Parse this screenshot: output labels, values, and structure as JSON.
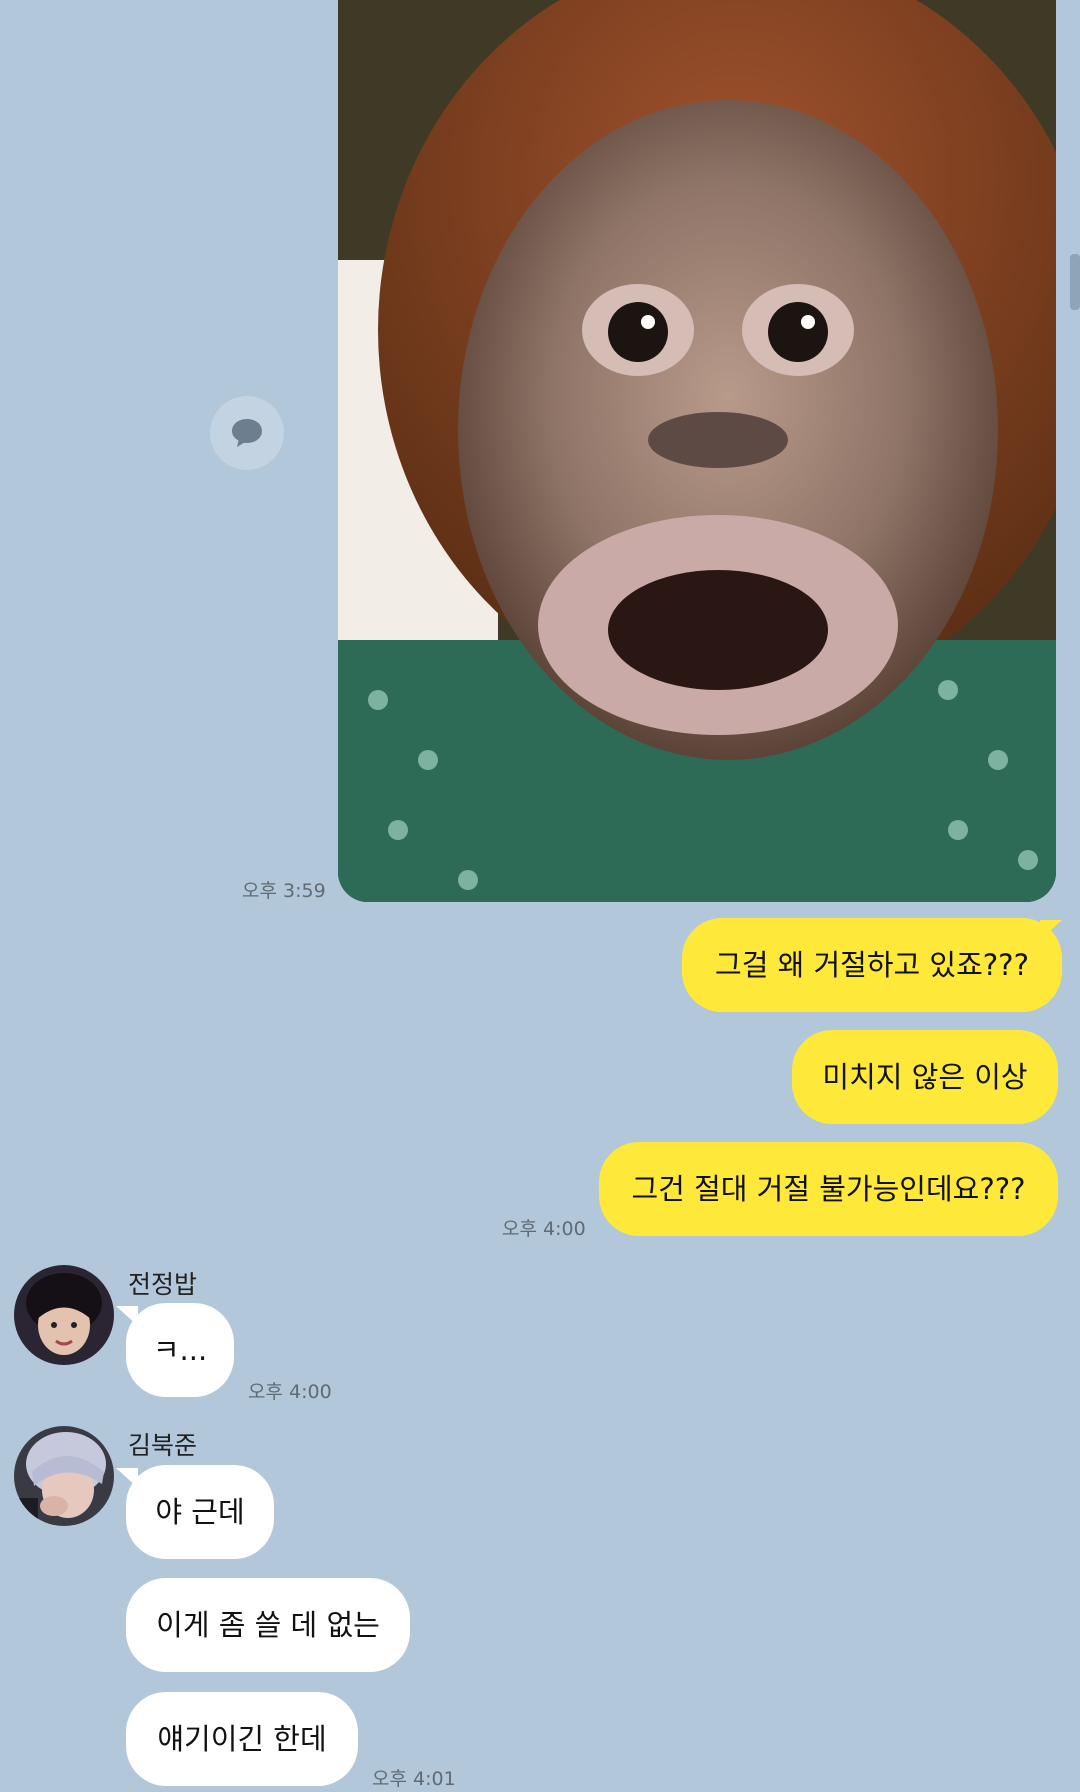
{
  "chat": {
    "image_message": {
      "time": "오후 3:59",
      "image_alt": "놀란 오랑우탄 사진"
    },
    "my_messages": [
      {
        "text": "그걸 왜 거절하고 있죠???"
      },
      {
        "text": "미치지 않은 이상"
      },
      {
        "text": "그건 절대 거절 불가능인데요???"
      }
    ],
    "my_messages_time": "오후 4:00",
    "sender1": {
      "name": "전정밥",
      "messages": [
        {
          "text": "ㅋ..."
        }
      ],
      "time": "오후 4:00"
    },
    "sender2": {
      "name": "김북준",
      "messages": [
        {
          "text": "야 근데"
        },
        {
          "text": "이게 좀 쓸 데 없는"
        },
        {
          "text": "얘기이긴 한데"
        }
      ],
      "time": "오후 4:01"
    }
  },
  "icons": {
    "share": "chat-bubble-icon"
  },
  "colors": {
    "background": "#b2c7da",
    "my_bubble": "#fee93b",
    "other_bubble": "#ffffff"
  }
}
